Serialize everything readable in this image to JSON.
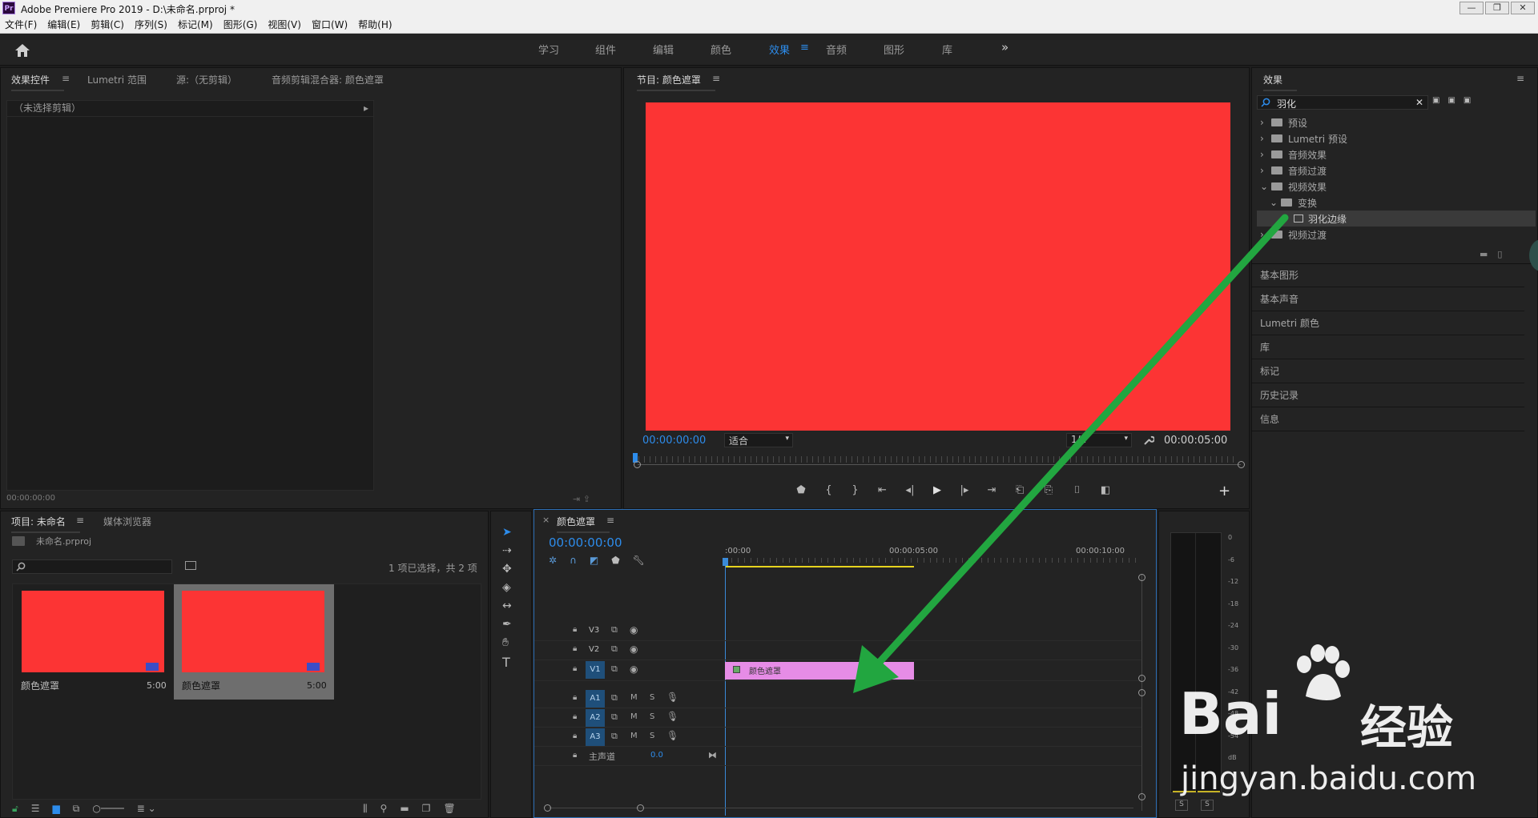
{
  "window": {
    "title": "Adobe Premiere Pro 2019 - D:\\未命名.prproj *",
    "app_badge": "Pr",
    "btn_min": "—",
    "btn_max": "❐",
    "btn_close": "✕"
  },
  "menu": [
    "文件(F)",
    "编辑(E)",
    "剪辑(C)",
    "序列(S)",
    "标记(M)",
    "图形(G)",
    "视图(V)",
    "窗口(W)",
    "帮助(H)"
  ],
  "workspaces": [
    {
      "label": "学习",
      "active": false
    },
    {
      "label": "组件",
      "active": false
    },
    {
      "label": "编辑",
      "active": false
    },
    {
      "label": "颜色",
      "active": false
    },
    {
      "label": "效果",
      "active": true
    },
    {
      "label": "音频",
      "active": false
    },
    {
      "label": "图形",
      "active": false
    },
    {
      "label": "库",
      "active": false
    }
  ],
  "workspace_more": "»",
  "source_panel": {
    "tabs": [
      "效果控件",
      "Lumetri 范围",
      "源:（无剪辑）",
      "音频剪辑混合器: 颜色遮罩"
    ],
    "no_clip": "（未选择剪辑）",
    "timecode": "00:00:00:00"
  },
  "program_monitor": {
    "title": "节目: 颜色遮罩",
    "timecode": "00:00:00:00",
    "fit": "适合",
    "quality": "1/2",
    "duration": "00:00:05:00",
    "frame_color": "#fc3434"
  },
  "effects_panel": {
    "title": "效果",
    "search_value": "羽化",
    "tree": [
      {
        "label": "预设",
        "level": 0,
        "type": "preset"
      },
      {
        "label": "Lumetri 预设",
        "level": 0,
        "type": "preset"
      },
      {
        "label": "音频效果",
        "level": 0,
        "type": "folder"
      },
      {
        "label": "音频过渡",
        "level": 0,
        "type": "folder"
      },
      {
        "label": "视频效果",
        "level": 0,
        "type": "folder",
        "open": true
      },
      {
        "label": "变换",
        "level": 1,
        "type": "folder",
        "open": true
      },
      {
        "label": "羽化边缘",
        "level": 2,
        "type": "effect",
        "selected": true
      },
      {
        "label": "视频过渡",
        "level": 0,
        "type": "folder"
      }
    ],
    "side_panels": [
      "基本图形",
      "基本声音",
      "Lumetri 颜色",
      "库",
      "标记",
      "历史记录",
      "信息"
    ]
  },
  "project_panel": {
    "tabs": [
      "项目: 未命名",
      "媒体浏览器"
    ],
    "file": "未命名.prproj",
    "selection": "1 项已选择，共 2 项",
    "items": [
      {
        "name": "颜色遮罩",
        "duration": "5:00",
        "selected": false
      },
      {
        "name": "颜色遮罩",
        "duration": "5:00",
        "selected": true
      }
    ]
  },
  "timeline": {
    "tab": "颜色遮罩",
    "timecode": "00:00:00:00",
    "ruler": [
      ":00:00",
      "00:00:05:00",
      "00:00:10:00"
    ],
    "video_tracks": [
      "V3",
      "V2",
      "V1"
    ],
    "audio_tracks": [
      "A1",
      "A2",
      "A3"
    ],
    "master": "主声道",
    "master_value": "0.0",
    "clip_label": "颜色遮罩",
    "clip_color": "#e68ce6",
    "track_m": "M",
    "track_s": "S"
  },
  "meter": {
    "ticks": [
      "0",
      "-6",
      "-12",
      "-18",
      "-24",
      "-30",
      "-36",
      "-42",
      "-48",
      "-54",
      "dB"
    ],
    "solo": "S"
  },
  "annotation": {
    "arrow_color": "#22a640"
  },
  "watermark": {
    "line1": "Bai",
    "line2": "经验",
    "line3": "jingyan.baidu.com"
  },
  "icons": {
    "close": "✕",
    "ham": "≡",
    "play": "▶",
    "expand": "▸"
  }
}
